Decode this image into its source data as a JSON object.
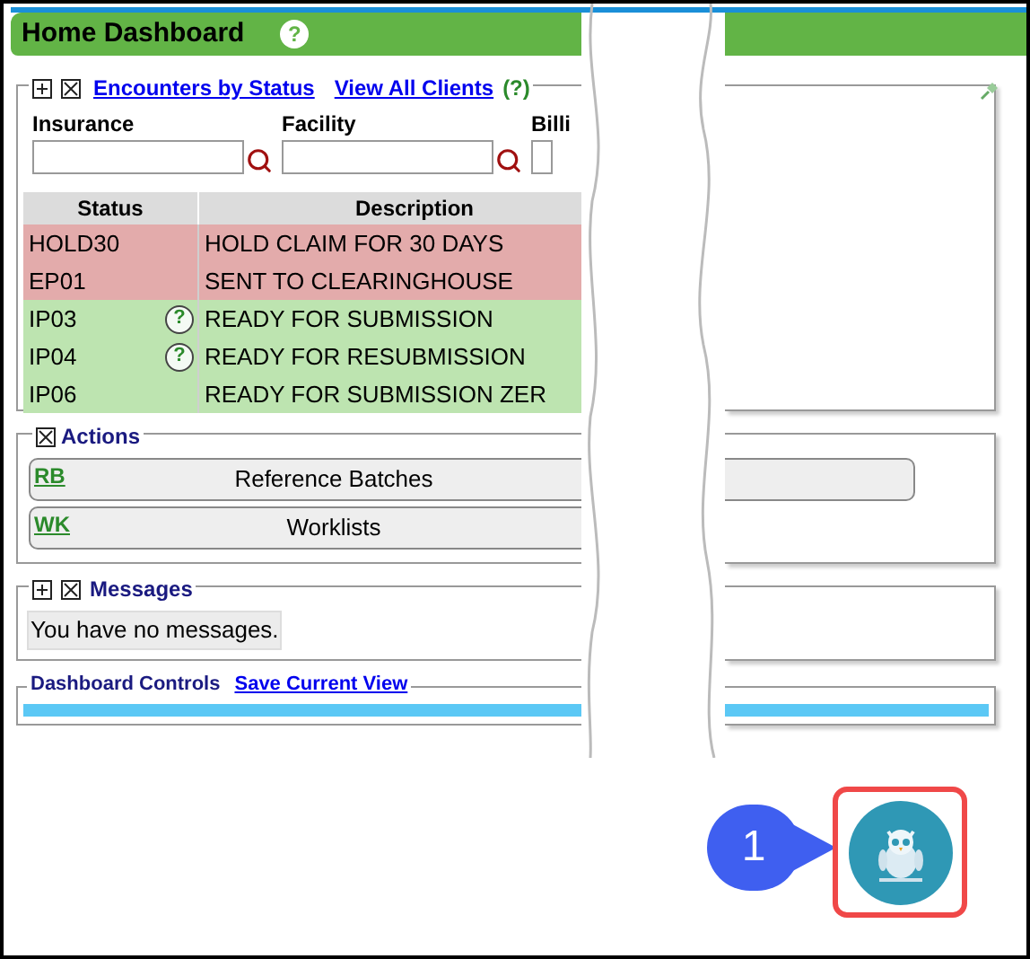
{
  "title": "Home Dashboard",
  "title_help": "?",
  "encounters": {
    "links": [
      "Encounters by Status",
      "View All Clients"
    ],
    "help": "(?)",
    "filters": [
      "Insurance",
      "Facility",
      "Billi"
    ],
    "columns": [
      "Status",
      "Description"
    ],
    "rows": [
      {
        "status": "HOLD30",
        "description": "HOLD CLAIM FOR 30 DAYS",
        "color": "#e3abab"
      },
      {
        "status": "EP01",
        "description": "SENT TO CLEARINGHOUSE",
        "color": "#e3abab"
      },
      {
        "status": "IP03",
        "description": "READY FOR SUBMISSION",
        "color": "#bde4b0",
        "help": "?"
      },
      {
        "status": "IP04",
        "description": "READY FOR RESUBMISSION",
        "color": "#bde4b0",
        "help": "?"
      },
      {
        "status": "IP06",
        "description": "READY FOR SUBMISSION ZER",
        "color": "#bde4b0"
      }
    ]
  },
  "actions": {
    "title": "Actions",
    "items": [
      {
        "key": "RB",
        "label": "Reference Batches"
      },
      {
        "key": "WK",
        "label": "Worklists"
      }
    ]
  },
  "messages": {
    "title": "Messages",
    "text": "You have no messages."
  },
  "dashboard_controls": {
    "title": "Dashboard Controls",
    "link": "Save Current View",
    "level": 1
  },
  "callout": "1"
}
